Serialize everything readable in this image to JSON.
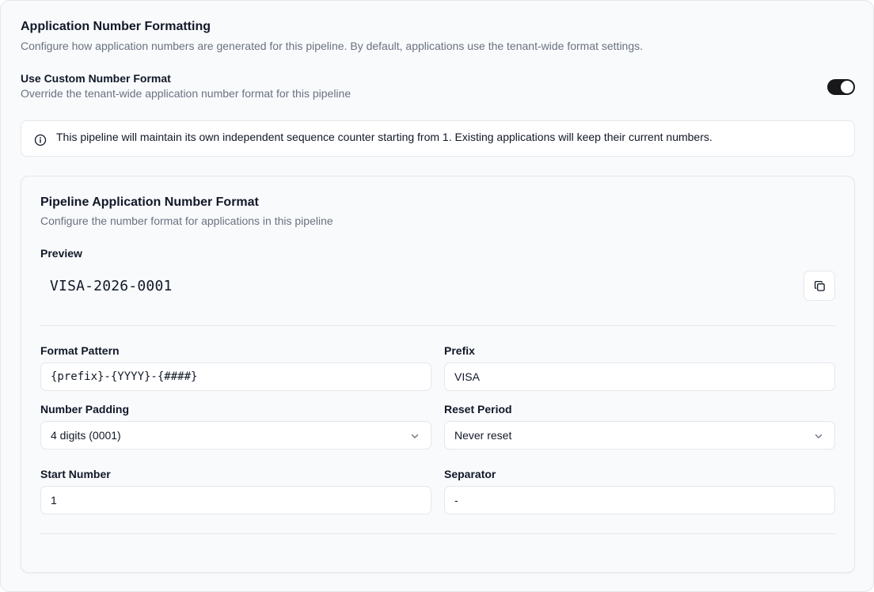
{
  "section": {
    "title": "Application Number Formatting",
    "description": "Configure how application numbers are generated for this pipeline. By default, applications use the tenant-wide format settings."
  },
  "custom_format": {
    "label": "Use Custom Number Format",
    "description": "Override the tenant-wide application number format for this pipeline",
    "enabled": true
  },
  "alert": {
    "icon": "info-icon",
    "text": "This pipeline will maintain its own independent sequence counter starting from 1. Existing applications will keep their current numbers."
  },
  "card": {
    "title": "Pipeline Application Number Format",
    "description": "Configure the number format for applications in this pipeline",
    "preview_label": "Preview",
    "preview_value": "VISA-2026-0001",
    "copy_icon": "copy-icon"
  },
  "fields": {
    "format_pattern": {
      "label": "Format Pattern",
      "value": "{prefix}-{YYYY}-{####}"
    },
    "prefix": {
      "label": "Prefix",
      "value": "VISA"
    },
    "number_padding": {
      "label": "Number Padding",
      "value": "4 digits (0001)"
    },
    "reset_period": {
      "label": "Reset Period",
      "value": "Never reset"
    },
    "start_number": {
      "label": "Start Number",
      "value": "1"
    },
    "separator": {
      "label": "Separator",
      "value": "-"
    }
  },
  "colors": {
    "toggle_on": "#18181b",
    "border": "#e5e7eb",
    "muted_text": "#6b7280"
  }
}
